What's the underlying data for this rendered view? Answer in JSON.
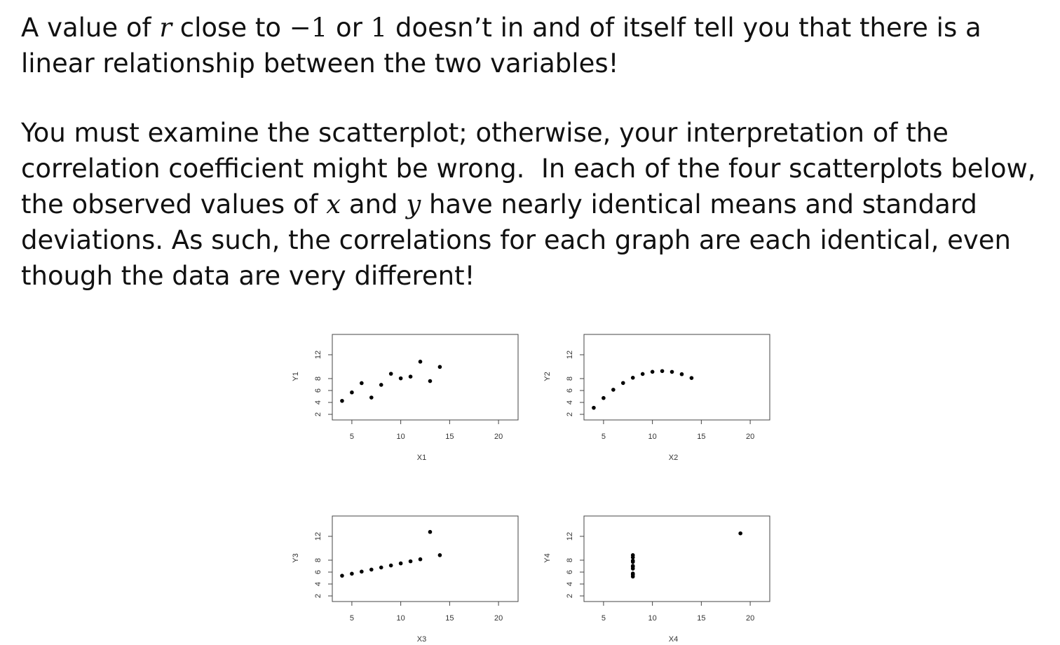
{
  "text": {
    "p1": "A value of r close to −1 or 1 doesn’t in and of itself tell you that there is a linear relationship between the two variables!",
    "p2": "You must examine the scatterplot; otherwise, your interpretation of the correlation coefficient might be wrong. In each of the four scatterplots below, the observed values of x and y have nearly identical means and standard deviations. As such, the correlations for each graph are each identical, even though the data are very different!"
  },
  "chart_data": [
    {
      "type": "scatter",
      "xlabel": "X1",
      "ylabel": "Y1",
      "xlim": [
        3,
        22
      ],
      "ylim": [
        2,
        14
      ],
      "xticks": [
        5,
        10,
        15,
        20
      ],
      "yticks": [
        2,
        4,
        6,
        8,
        12
      ],
      "x": [
        10,
        8,
        13,
        9,
        11,
        14,
        6,
        4,
        12,
        7,
        5
      ],
      "y": [
        8.04,
        6.95,
        7.58,
        8.81,
        8.33,
        9.96,
        7.24,
        4.26,
        10.84,
        4.82,
        5.68
      ]
    },
    {
      "type": "scatter",
      "xlabel": "X2",
      "ylabel": "Y2",
      "xlim": [
        3,
        22
      ],
      "ylim": [
        2,
        14
      ],
      "xticks": [
        5,
        10,
        15,
        20
      ],
      "yticks": [
        2,
        4,
        6,
        8,
        12
      ],
      "x": [
        10,
        8,
        13,
        9,
        11,
        14,
        6,
        4,
        12,
        7,
        5
      ],
      "y": [
        9.14,
        8.14,
        8.74,
        8.77,
        9.26,
        8.1,
        6.13,
        3.1,
        9.13,
        7.26,
        4.74
      ]
    },
    {
      "type": "scatter",
      "xlabel": "X3",
      "ylabel": "Y3",
      "xlim": [
        3,
        22
      ],
      "ylim": [
        2,
        14
      ],
      "xticks": [
        5,
        10,
        15,
        20
      ],
      "yticks": [
        2,
        4,
        6,
        8,
        12
      ],
      "x": [
        10,
        8,
        13,
        9,
        11,
        14,
        6,
        4,
        12,
        7,
        5
      ],
      "y": [
        7.46,
        6.77,
        12.74,
        7.11,
        7.81,
        8.84,
        6.08,
        5.39,
        8.15,
        6.42,
        5.73
      ]
    },
    {
      "type": "scatter",
      "xlabel": "X4",
      "ylabel": "Y4",
      "xlim": [
        3,
        22
      ],
      "ylim": [
        2,
        14
      ],
      "xticks": [
        5,
        10,
        15,
        20
      ],
      "yticks": [
        2,
        4,
        6,
        8,
        12
      ],
      "x": [
        8,
        8,
        8,
        8,
        8,
        8,
        8,
        19,
        8,
        8,
        8
      ],
      "y": [
        6.58,
        5.76,
        7.71,
        8.84,
        8.47,
        7.04,
        5.25,
        12.5,
        5.56,
        7.91,
        6.89
      ]
    }
  ]
}
